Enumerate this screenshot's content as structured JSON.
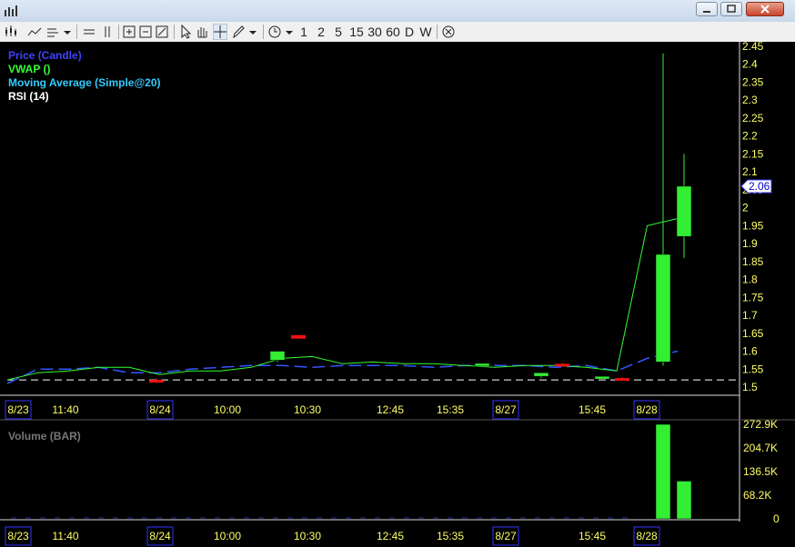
{
  "toolbar": {
    "periods": [
      "1",
      "2",
      "5",
      "15",
      "30",
      "60",
      "D",
      "W"
    ]
  },
  "legend": {
    "price": "Price (Candle)",
    "vwap": "VWAP ()",
    "ma": "Moving Average (Simple@20)",
    "rsi": "RSI (14)",
    "volume": "Volume (BAR)"
  },
  "colors": {
    "price_legend": "#4040ff",
    "vwap": "#33ff33",
    "ma": "#33ccff",
    "up_candle": "#33ee33",
    "down_candle": "#ee1111",
    "axis_text": "#ffff66",
    "date_box": "#3333ff"
  },
  "chart_data": [
    {
      "type": "candlestick",
      "ylim": [
        1.49,
        2.46
      ],
      "y_ticks": [
        "2.45",
        "2.4",
        "2.35",
        "2.3",
        "2.25",
        "2.2",
        "2.15",
        "2.1",
        "2.05",
        "2",
        "1.95",
        "1.9",
        "1.85",
        "1.8",
        "1.75",
        "1.7",
        "1.65",
        "1.6",
        "1.55",
        "1.5"
      ],
      "current_price": "2.06",
      "x_labels": [
        "8/23",
        "11:40",
        "8/24",
        "10:00",
        "10:30",
        "12:45",
        "15:35",
        "8/27",
        "15:45",
        "8/28"
      ],
      "date_labels": [
        "8/23",
        "8/24",
        "8/27",
        "8/28"
      ],
      "candles": [
        {
          "open": 1.52,
          "high": 1.525,
          "low": 1.515,
          "close": 1.515
        },
        {
          "open": 1.575,
          "high": 1.58,
          "low": 1.57,
          "close": 1.6
        },
        {
          "open": 1.645,
          "high": 1.645,
          "low": 1.635,
          "close": 1.635
        },
        {
          "open": 1.562,
          "high": 1.566,
          "low": 1.56,
          "close": 1.566
        },
        {
          "open": 1.53,
          "high": 1.535,
          "low": 1.525,
          "close": 1.54
        },
        {
          "open": 1.565,
          "high": 1.566,
          "low": 1.558,
          "close": 1.558
        },
        {
          "open": 1.528,
          "high": 1.53,
          "low": 1.526,
          "close": 1.53
        },
        {
          "open": 1.525,
          "high": 1.528,
          "low": 1.52,
          "close": 1.52
        },
        {
          "open": 1.57,
          "high": 2.43,
          "low": 1.56,
          "close": 1.87
        },
        {
          "open": 1.92,
          "high": 2.15,
          "low": 1.86,
          "close": 2.06
        }
      ],
      "vwap": [
        1.52,
        1.54,
        1.545,
        1.555,
        1.555,
        1.535,
        1.545,
        1.545,
        1.555,
        1.58,
        1.585,
        1.565,
        1.57,
        1.565,
        1.565,
        1.56,
        1.555,
        1.56,
        1.56,
        1.555,
        1.545,
        1.95,
        1.97
      ],
      "moving_average": [
        1.51,
        1.55,
        1.55,
        1.555,
        1.54,
        1.54,
        1.55,
        1.555,
        1.56,
        1.56,
        1.555,
        1.56,
        1.56,
        1.56,
        1.555,
        1.56,
        1.56,
        1.56,
        1.555,
        1.56,
        1.545,
        1.58,
        1.6
      ],
      "reference_level": 1.52
    },
    {
      "type": "bar",
      "title": "Volume (BAR)",
      "y_ticks": [
        "272.9K",
        "204.7K",
        "136.5K",
        "68.2K",
        "0"
      ],
      "ylim": [
        0,
        272900
      ],
      "bars": [
        {
          "label": "8/28 a",
          "value": 272900
        },
        {
          "label": "8/28 b",
          "value": 109000
        }
      ]
    }
  ]
}
